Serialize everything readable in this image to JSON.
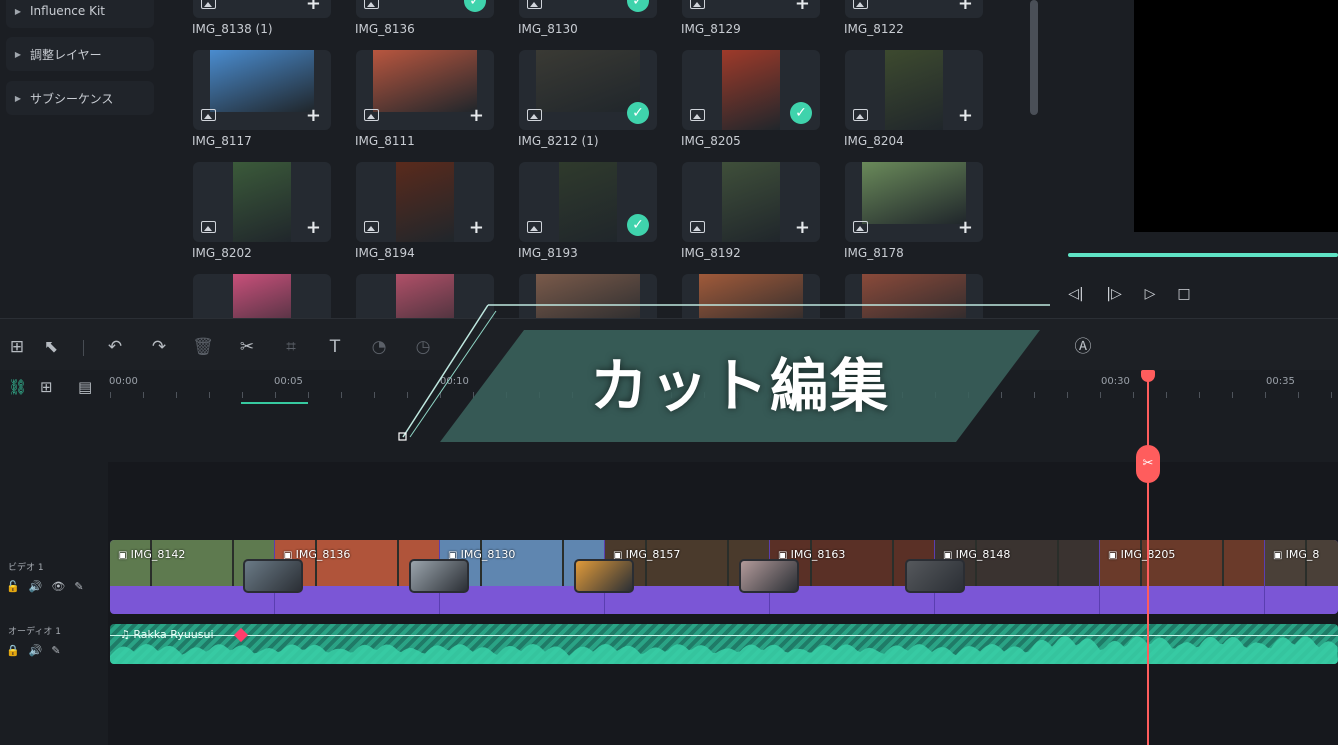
{
  "left_panel": {
    "items": [
      {
        "label": "Influence Kit"
      },
      {
        "label": "調整レイヤー"
      },
      {
        "label": "サブシーケンス"
      }
    ]
  },
  "media": {
    "rows": [
      [
        {
          "label": "IMG_8138 (1)",
          "state": "add",
          "color": "#6b8f6a",
          "shape": "wide"
        },
        {
          "label": "IMG_8136",
          "state": "check",
          "color": "#c7543a",
          "shape": "wide"
        },
        {
          "label": "IMG_8130",
          "state": "check",
          "color": "#4f6f8a",
          "shape": "wide"
        },
        {
          "label": "IMG_8129",
          "state": "add",
          "color": "#7a7f6a",
          "shape": "wide"
        },
        {
          "label": "IMG_8122",
          "state": "add",
          "color": "#5d7a4d",
          "shape": "wide"
        }
      ],
      [
        {
          "label": "IMG_8117",
          "state": "add",
          "color": "#4a8ccf",
          "shape": "wide"
        },
        {
          "label": "IMG_8111",
          "state": "add",
          "color": "#b8563f",
          "shape": "wide"
        },
        {
          "label": "IMG_8212 (1)",
          "state": "check",
          "color": "#3a3a34",
          "shape": "wide"
        },
        {
          "label": "IMG_8205",
          "state": "check",
          "color": "#9e3a2a",
          "shape": "tall"
        },
        {
          "label": "IMG_8204",
          "state": "add",
          "color": "#3d4a2f",
          "shape": "tall"
        }
      ],
      [
        {
          "label": "IMG_8202",
          "state": "add",
          "color": "#3b5a3a",
          "shape": "tall"
        },
        {
          "label": "IMG_8194",
          "state": "add",
          "color": "#5a2a1c",
          "shape": "tall"
        },
        {
          "label": "IMG_8193",
          "state": "check",
          "color": "#2f3a2c",
          "shape": "tall"
        },
        {
          "label": "IMG_8192",
          "state": "add",
          "color": "#3f4f3a",
          "shape": "tall"
        },
        {
          "label": "IMG_8178",
          "state": "add",
          "color": "#6a8a5a",
          "shape": "wide"
        }
      ],
      [
        {
          "label": "",
          "state": "none",
          "color": "#c8507a",
          "shape": "tall"
        },
        {
          "label": "",
          "state": "none",
          "color": "#b05068",
          "shape": "tall"
        },
        {
          "label": "",
          "state": "none",
          "color": "#7a5a4a",
          "shape": "wide"
        },
        {
          "label": "",
          "state": "none",
          "color": "#a05a3a",
          "shape": "wide"
        },
        {
          "label": "",
          "state": "none",
          "color": "#8a4a3a",
          "shape": "wide"
        }
      ]
    ]
  },
  "preview": {
    "controls": [
      {
        "name": "prev-frame-button",
        "glyph": "◁|"
      },
      {
        "name": "next-frame-button",
        "glyph": "|▷"
      },
      {
        "name": "play-button",
        "glyph": "▷"
      },
      {
        "name": "stop-button",
        "glyph": "□"
      }
    ]
  },
  "toolbar": {
    "icons": [
      {
        "name": "layout-grid-icon",
        "glyph": "⊞",
        "dim": false
      },
      {
        "name": "select-tool-icon",
        "glyph": "⬉",
        "dim": false
      },
      {
        "name": "undo-icon",
        "glyph": "↶",
        "dim": false
      },
      {
        "name": "redo-icon",
        "glyph": "↷",
        "dim": false
      },
      {
        "name": "delete-icon",
        "glyph": "🗑",
        "dim": true
      },
      {
        "name": "cut-icon",
        "glyph": "✂",
        "dim": false
      },
      {
        "name": "crop-icon",
        "glyph": "⌗",
        "dim": true
      },
      {
        "name": "text-icon",
        "glyph": "T",
        "dim": false
      },
      {
        "name": "speed-icon",
        "glyph": "◔",
        "dim": true
      },
      {
        "name": "timer-icon",
        "glyph": "◷",
        "dim": true
      }
    ],
    "right_icon": {
      "name": "translate-icon",
      "glyph": "Ⓐ"
    }
  },
  "ruler": {
    "ticks": [
      "00:00",
      "00:05",
      "00:10",
      "00:30",
      "00:35"
    ]
  },
  "timeline": {
    "video_track": {
      "label": "ビデオ 1"
    },
    "audio_track": {
      "label": "オーディオ 1",
      "clip": "Rakka Ryuusui"
    },
    "clips": [
      {
        "name": "IMG_8142",
        "color": "#5e7a4f"
      },
      {
        "name": "IMG_8136",
        "color": "#b0543a"
      },
      {
        "name": "IMG_8130",
        "color": "#5f86b0"
      },
      {
        "name": "IMG_8157",
        "color": "#4a3a2c"
      },
      {
        "name": "IMG_8163",
        "color": "#5a3026"
      },
      {
        "name": "IMG_8148",
        "color": "#3a3330"
      },
      {
        "name": "IMG_8205",
        "color": "#6a3a2a"
      },
      {
        "name": "IMG_8",
        "color": "#4a4038"
      }
    ],
    "transitions": [
      {
        "color": "#6a7a86"
      },
      {
        "color": "#9aa4ac"
      },
      {
        "color": "#e09a3a"
      },
      {
        "color": "#b29a9a"
      },
      {
        "color": "#55585c"
      }
    ],
    "colors": {
      "video": "#7b56d6",
      "audio": "#2aa385",
      "playhead": "#ff5d5d"
    }
  },
  "overlay": {
    "title": "カット編集"
  }
}
